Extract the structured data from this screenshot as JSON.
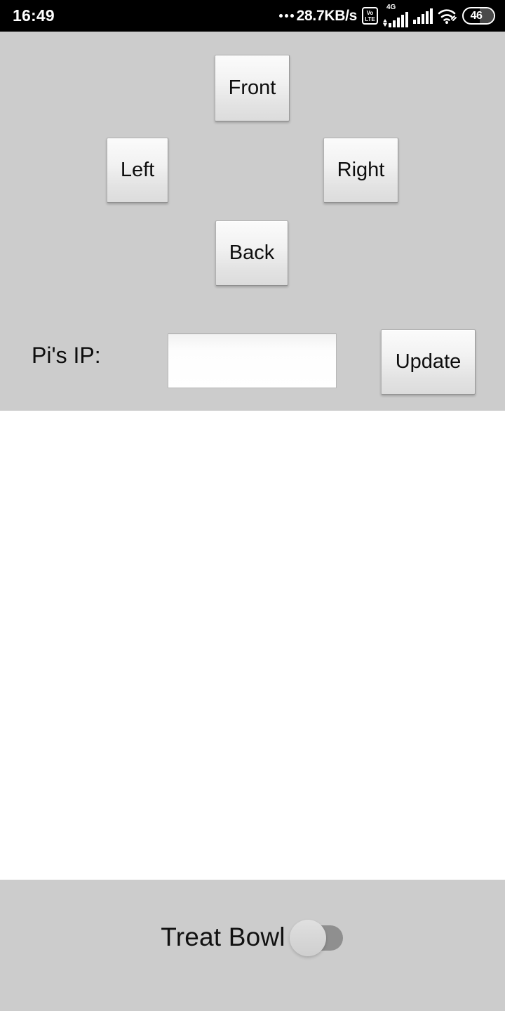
{
  "status_bar": {
    "time": "16:49",
    "network_speed": "28.7KB/s",
    "volte_line1": "Vo",
    "volte_line2": "LTE",
    "network_type": "4G",
    "battery_level": "46",
    "icons": [
      "volte-icon",
      "signal-4g-icon",
      "signal-icon",
      "wifi-icon",
      "battery-icon"
    ]
  },
  "controls": {
    "front_label": "Front",
    "left_label": "Left",
    "right_label": "Right",
    "back_label": "Back"
  },
  "ip_section": {
    "label": "Pi's IP:",
    "value": "",
    "placeholder": "",
    "update_label": "Update"
  },
  "bottom": {
    "treat_label": "Treat Bowl",
    "treat_switch_state": "off"
  },
  "colors": {
    "panel_bg": "#cccccc",
    "content_bg": "#ffffff",
    "status_bg": "#000000",
    "switch_track": "#8f8f8f",
    "switch_thumb": "#d6d6d6"
  }
}
